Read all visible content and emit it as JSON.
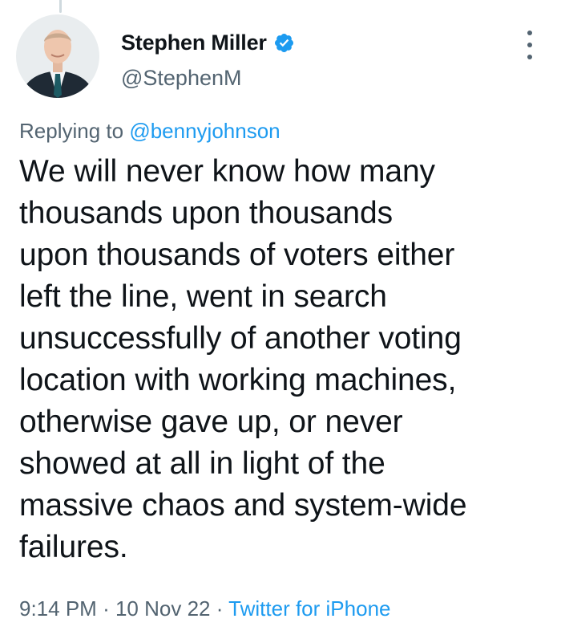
{
  "author": {
    "display_name": "Stephen Miller",
    "handle": "@StephenM",
    "verified": true
  },
  "reply": {
    "prefix": "Replying to",
    "handle": "@bennyjohnson"
  },
  "tweet": {
    "lines": [
      "We will never know how many",
      "thousands upon thousands",
      "upon thousands of voters either",
      "left the line, went in search",
      "unsuccessfully of another voting",
      "location with working machines,",
      "otherwise gave up, or never",
      "showed at all in light of the",
      "massive chaos and system-wide",
      "failures."
    ]
  },
  "meta": {
    "time": "9:14 PM",
    "separator": "·",
    "date": "10 Nov 22",
    "source": "Twitter for iPhone"
  },
  "colors": {
    "accent": "#1d9bf0",
    "secondary_text": "#536471",
    "primary_text": "#0f1419"
  },
  "icons": {
    "verified": "verified-badge-icon",
    "more": "more-options-icon"
  }
}
